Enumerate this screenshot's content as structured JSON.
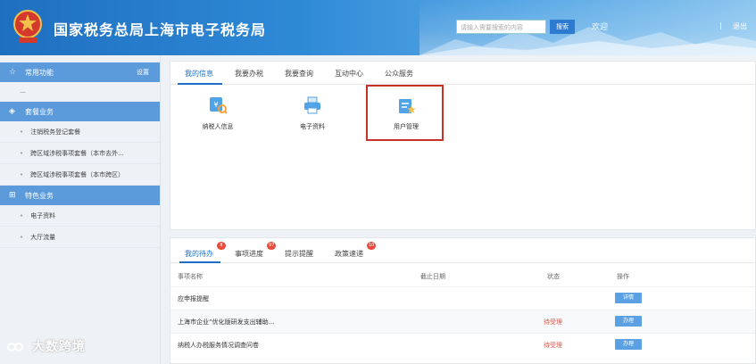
{
  "header": {
    "title": "国家税务总局上海市电子税务局",
    "search_placeholder": "请输入需要搜索的内容",
    "search_button": "搜索",
    "welcome": "欢迎",
    "separator": "|",
    "logout": "退出"
  },
  "sidebar": {
    "common": {
      "label": "常用功能",
      "action": "设置"
    },
    "common_empty": "—",
    "package": {
      "label": "套餐业务"
    },
    "package_items": [
      "注销税务登记套餐",
      "跨区域涉税事项套餐（本市去外...",
      "跨区域涉税事项套餐（本市跨区）"
    ],
    "feature": {
      "label": "特色业务"
    },
    "feature_items": [
      "电子资料",
      "大厅流量"
    ]
  },
  "info_panel": {
    "tabs": [
      "我的信息",
      "我要办税",
      "我要查询",
      "互动中心",
      "公众服务"
    ],
    "tiles": [
      {
        "label": "纳税人信息",
        "icon": "taxpayer-info-icon"
      },
      {
        "label": "电子资料",
        "icon": "printer-icon"
      },
      {
        "label": "用户管理",
        "icon": "user-management-icon"
      }
    ]
  },
  "todo_panel": {
    "tabs": [
      {
        "label": "我的待办",
        "badge": "8"
      },
      {
        "label": "事项进度",
        "badge": "97"
      },
      {
        "label": "提示提醒",
        "badge": ""
      },
      {
        "label": "政策速递",
        "badge": "10"
      }
    ],
    "columns": [
      "事项名称",
      "截止日期",
      "状态",
      "操作"
    ],
    "rows": [
      {
        "name": "应申报提醒",
        "deadline": "",
        "status": "",
        "action": "详情"
      },
      {
        "name": "上海市企业“优化版研发支出辅助...",
        "deadline": "",
        "status": "待受理",
        "action": "办理"
      },
      {
        "name": "纳税人办税服务情况调查问卷",
        "deadline": "",
        "status": "待受理",
        "action": "办理"
      }
    ]
  },
  "watermark": "大数跨境",
  "colors": {
    "header_blue": "#1e6fc0",
    "sidebar_head": "#5b9bdc",
    "accent": "#1d6fc4",
    "highlight": "#c8312b",
    "status_red": "#e05a4e"
  }
}
